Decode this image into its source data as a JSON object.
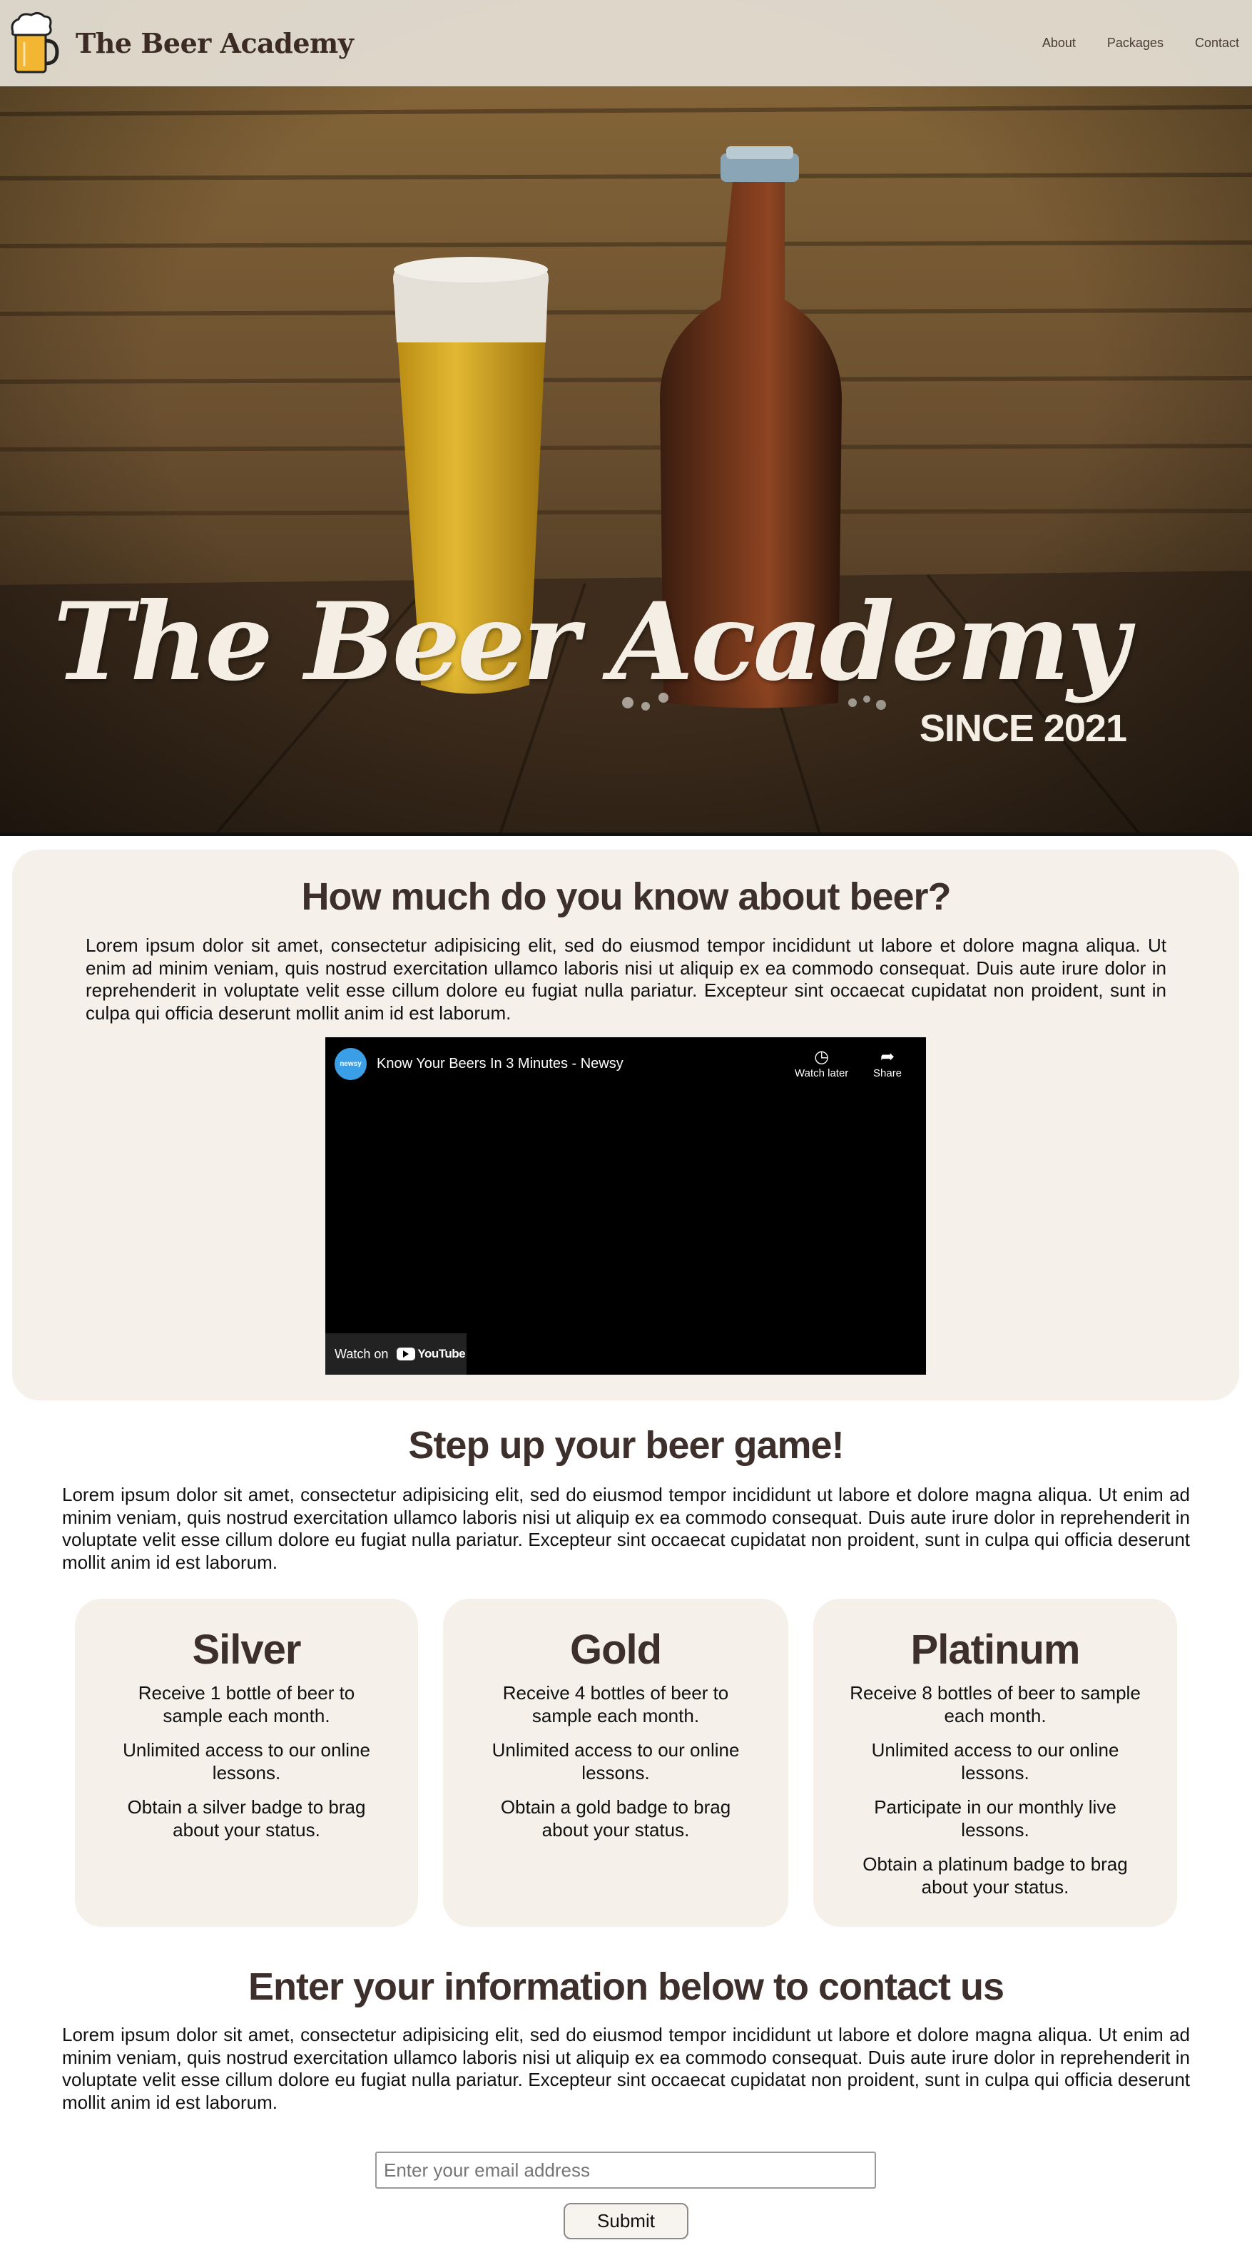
{
  "header": {
    "brand_name": "The Beer Academy",
    "nav": [
      "About",
      "Packages",
      "Contact"
    ]
  },
  "hero": {
    "title": "The Beer Academy",
    "subtitle": "SINCE 2021"
  },
  "quiz": {
    "title": "How much do you know about beer?",
    "paragraph": "Lorem ipsum dolor sit amet, consectetur adipisicing elit, sed do eiusmod tempor incididunt ut labore et dolore magna aliqua. Ut enim ad minim veniam, quis nostrud exercitation ullamco laboris nisi ut aliquip ex ea commodo consequat. Duis aute irure dolor in reprehenderit in voluptate velit esse cillum dolore eu fugiat nulla pariatur. Excepteur sint occaecat cupidatat non proident, sunt in culpa qui officia deserunt mollit anim id est laborum.",
    "video": {
      "channel_avatar": "newsy",
      "title": "Know Your Beers In 3 Minutes - Newsy",
      "watch_later": "Watch later",
      "share": "Share",
      "watch_on": "Watch on",
      "youtube": "YouTube"
    }
  },
  "game": {
    "title": "Step up your beer game!",
    "paragraph": "Lorem ipsum dolor sit amet, consectetur adipisicing elit, sed do eiusmod tempor incididunt ut labore et dolore magna aliqua. Ut enim ad minim veniam, quis nostrud exercitation ullamco laboris nisi ut aliquip ex ea commodo consequat. Duis aute irure dolor in reprehenderit in voluptate velit esse cillum dolore eu fugiat nulla pariatur. Excepteur sint occaecat cupidatat non proident, sunt in culpa qui officia deserunt mollit anim id est laborum.",
    "packages": [
      {
        "name": "Silver",
        "features": [
          "Receive 1 bottle of beer to sample each month.",
          "Unlimited access to our online lessons.",
          "Obtain a silver badge to brag about your status."
        ]
      },
      {
        "name": "Gold",
        "features": [
          "Receive 4 bottles of beer to sample each month.",
          "Unlimited access to our online lessons.",
          "Obtain a gold badge to brag about your status."
        ]
      },
      {
        "name": "Platinum",
        "features": [
          "Receive 8 bottles of beer to sample each month.",
          "Unlimited access to our online lessons.",
          "Participate in our monthly live lessons.",
          "Obtain a platinum badge to brag about your status."
        ]
      }
    ]
  },
  "contact": {
    "title": "Enter your information below to contact us",
    "paragraph": "Lorem ipsum dolor sit amet, consectetur adipisicing elit, sed do eiusmod tempor incididunt ut labore et dolore magna aliqua. Ut enim ad minim veniam, quis nostrud exercitation ullamco laboris nisi ut aliquip ex ea commodo consequat. Duis aute irure dolor in reprehenderit in voluptate velit esse cillum dolore eu fugiat nulla pariatur. Excepteur sint occaecat cupidatat non proident, sunt in culpa qui officia deserunt mollit anim id est laborum.",
    "email_placeholder": "Enter your email address",
    "email_value": "",
    "submit_label": "Submit"
  },
  "colors": {
    "header_bg": "#e1dbcf",
    "heading": "#3d2f2b",
    "card_bg": "#f5f0ea",
    "hero_text": "#f4eee4"
  }
}
